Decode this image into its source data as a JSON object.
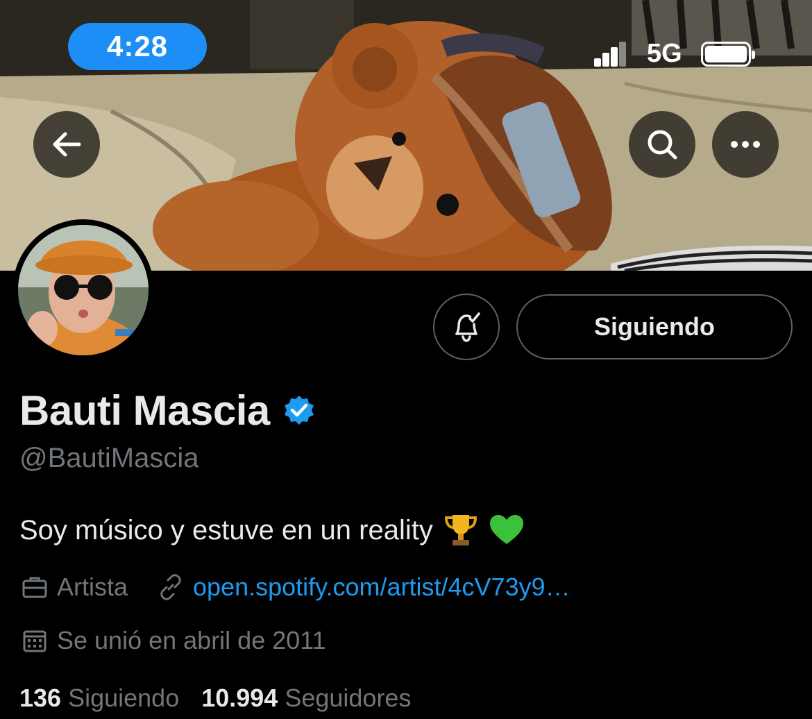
{
  "status_bar": {
    "time": "4:28",
    "network": "5G",
    "signal_bars": 3,
    "battery_level": 1.0
  },
  "profile": {
    "name": "Bauti Mascia",
    "handle": "@BautiMascia",
    "bio": "Soy músico y estuve en un reality",
    "bio_emojis": [
      "trophy",
      "green-heart"
    ],
    "category": "Artista",
    "link": "open.spotify.com/artist/4cV73y9…",
    "joined": "Se unió en abril de 2011",
    "following_count": "136",
    "following_label": "Siguiendo",
    "followers_count": "10.994",
    "followers_label": "Seguidores"
  },
  "actions": {
    "follow_state": "Siguiendo"
  },
  "colors": {
    "background": "#000000",
    "accent": "#1d9bf0",
    "secondary_text": "#71767b",
    "time_pill": "#1e8ef7"
  }
}
